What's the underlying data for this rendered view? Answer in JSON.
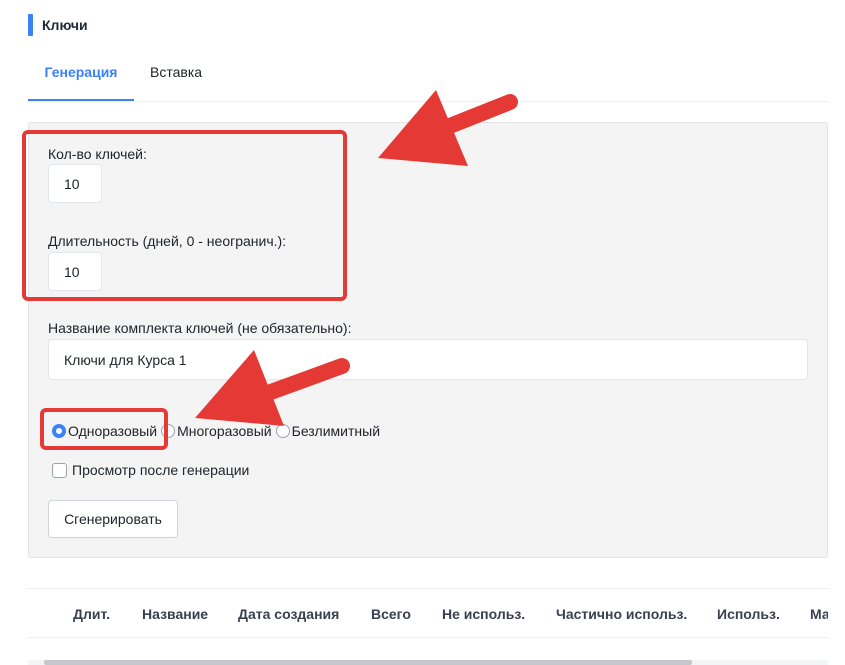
{
  "page": {
    "title": "Ключи"
  },
  "tabs": [
    {
      "label": "Генерация",
      "active": true
    },
    {
      "label": "Вставка",
      "active": false
    }
  ],
  "form": {
    "keys_count": {
      "label": "Кол-во ключей:",
      "value": "10"
    },
    "duration": {
      "label": "Длительность (дней, 0 - неогранич.):",
      "value": "10"
    },
    "set_name": {
      "label": "Название комплекта ключей (не обязательно):",
      "value": "Ключи для Курса 1"
    },
    "usage_type": {
      "options": [
        "Одноразовый",
        "Многоразовый",
        "Безлимитный"
      ],
      "selected": "Одноразовый"
    },
    "preview": {
      "label": "Просмотр после генерации",
      "checked": false
    },
    "generate_button": "Сгенерировать"
  },
  "table": {
    "columns": [
      "Длит.",
      "Название",
      "Дата создания",
      "Всего",
      "Не использ.",
      "Частично использ.",
      "Использ.",
      "Ма"
    ]
  },
  "colors": {
    "accent": "#3b82f6",
    "annotation": "#e53935",
    "panel_bg": "#f4f4f5"
  }
}
